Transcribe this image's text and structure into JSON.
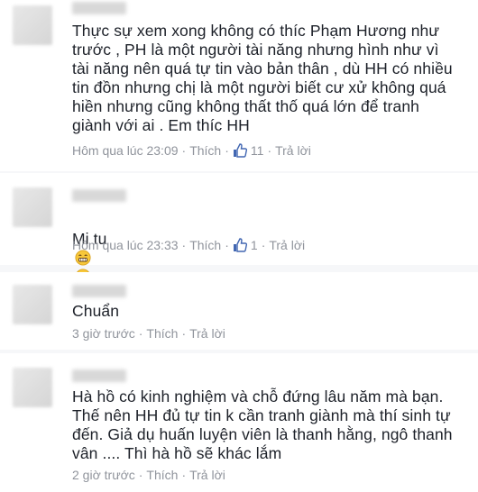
{
  "comments": [
    {
      "text": "Thực sự xem xong không có thíc Phạm Hương như trước , PH là một người tài năng nhưng hình như vì tài năng nên quá tự tin vào bản thân , dù HH có nhiều tin đồn nhưng chị là một người biết cư xử không quá hiền nhưng cũng không thất thố quá lớn để tranh giành với ai . Em thíc HH",
      "time": "Hôm qua lúc 23:09",
      "like_label": "Thích",
      "like_count": "11",
      "reply_label": "Trả lời"
    },
    {
      "text": "Mi tu",
      "emoji_icon": "grinning-face-icon",
      "time": "Hôm qua lúc 23:33",
      "like_label": "Thích",
      "like_count": "1",
      "reply_label": "Trả lời"
    },
    {
      "text": "Chuẩn",
      "time": "3 giờ trước",
      "like_label": "Thích",
      "reply_label": "Trả lời"
    },
    {
      "text": "Hà hồ có kinh nghiệm và chỗ đứng lâu năm mà bạn. Thế nên HH đủ tự tin k cần tranh giành mà thí sinh tự đến. Giả dụ huấn luyện viên là thanh hằng, ngô thanh vân .... Thì hà hồ sẽ khác lắm",
      "time": "2 giờ trước",
      "like_label": "Thích",
      "reply_label": "Trả lời"
    }
  ],
  "colors": {
    "text": "#1d2129",
    "meta": "#90949c",
    "like_blue": "#4267b2",
    "emoji_yellow": "#f7c73a"
  }
}
